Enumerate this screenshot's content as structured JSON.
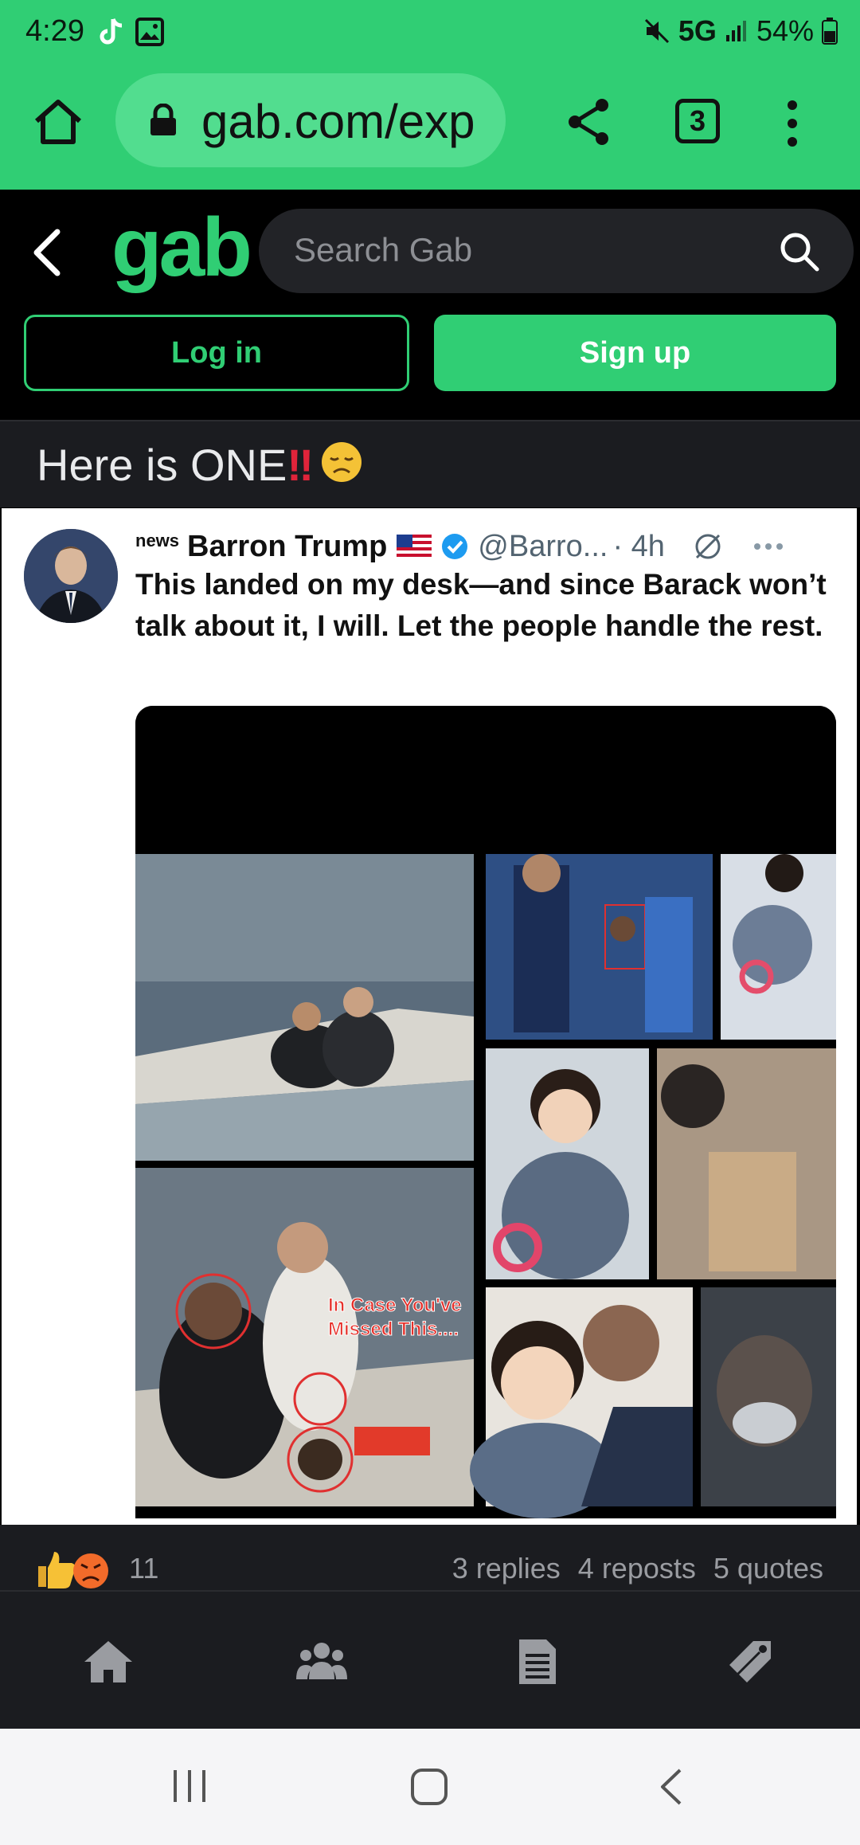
{
  "status_bar": {
    "time": "4:29",
    "network": "5G",
    "battery": "54%"
  },
  "browser": {
    "url": "gab.com/exp",
    "tab_count": "3"
  },
  "gab": {
    "logo": "gab",
    "search_placeholder": "Search Gab",
    "login_label": "Log in",
    "signup_label": "Sign up"
  },
  "post": {
    "text": "Here is ONE"
  },
  "embed": {
    "news_label": "news",
    "author": "Barron Trump",
    "handle": "@Barro...",
    "time": "· 4h",
    "tweet_text": "This landed on my desk—and since Barack won’t talk about it, I will. Let the people handle the rest.",
    "overlay_text": "In Case You've Missed This...."
  },
  "stats": {
    "reaction_count": "11",
    "replies": "3 replies",
    "reposts": "4 reposts",
    "quotes": "5 quotes"
  },
  "colors": {
    "brand": "#30CE74",
    "dark": "#1b1c20"
  },
  "icons": {
    "nav": [
      "home-icon",
      "groups-icon",
      "news-icon",
      "marketplace-tag-icon"
    ]
  }
}
